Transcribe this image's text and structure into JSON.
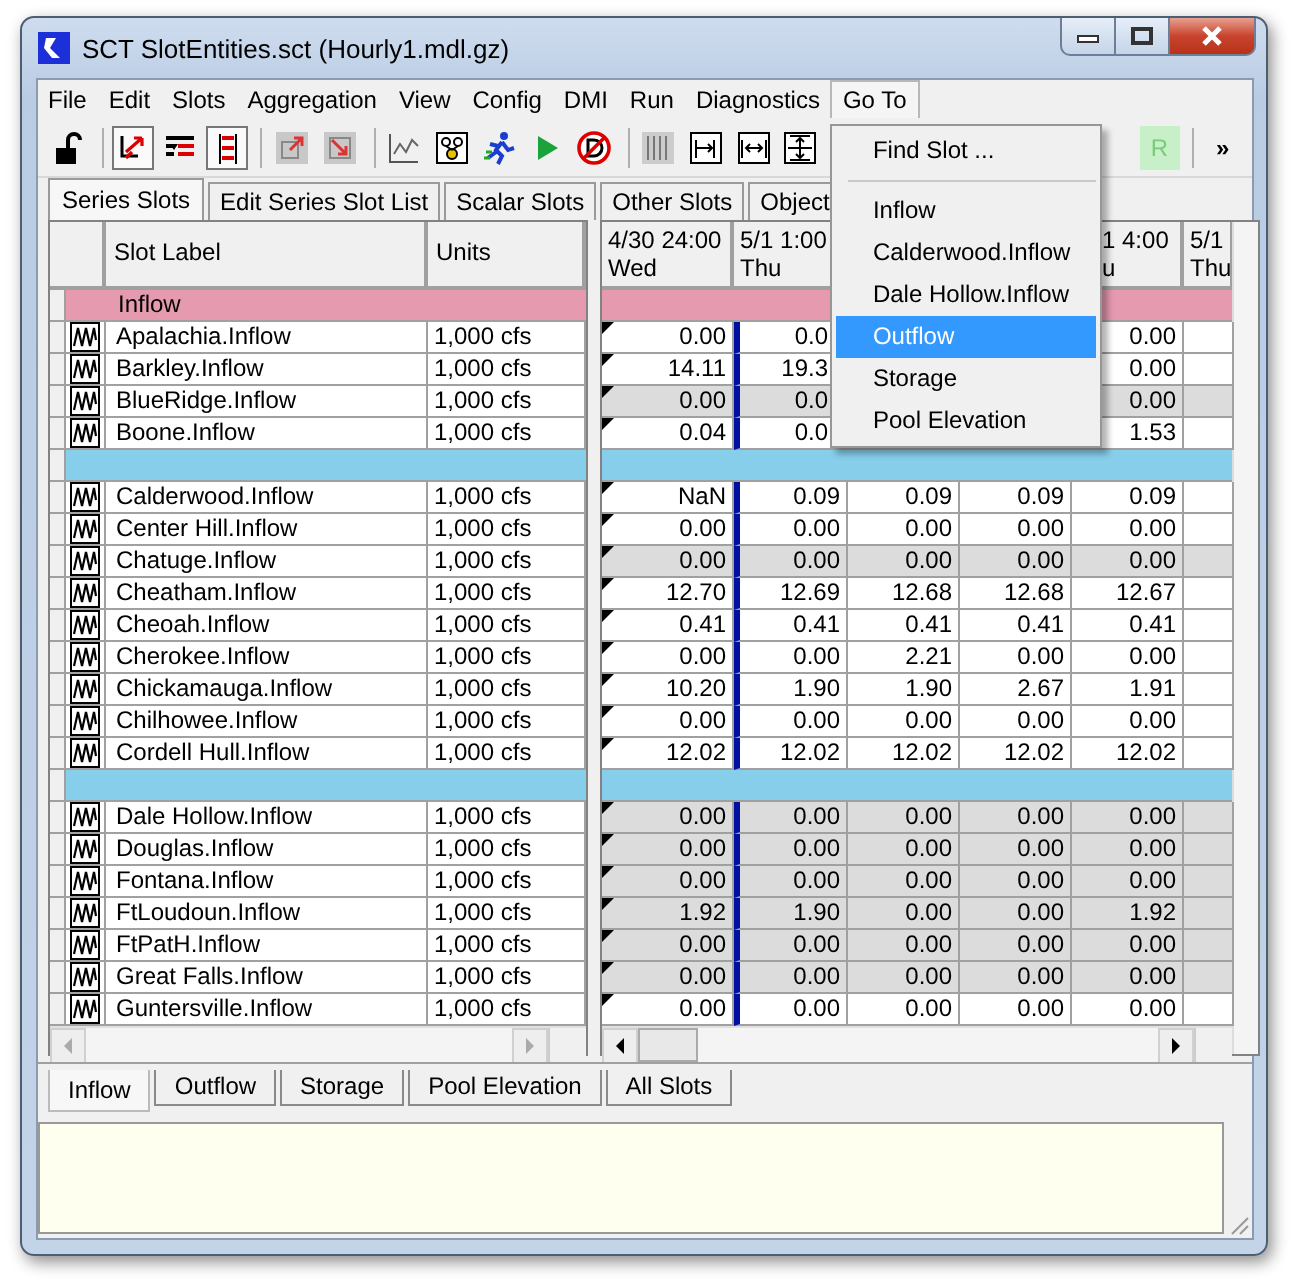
{
  "window": {
    "title": "SCT SlotEntities.sct (Hourly1.mdl.gz)"
  },
  "menu_bar": [
    {
      "label": "File",
      "selected": false
    },
    {
      "label": "Edit",
      "selected": false
    },
    {
      "label": "Slots",
      "selected": false
    },
    {
      "label": "Aggregation",
      "selected": false
    },
    {
      "label": "View",
      "selected": false
    },
    {
      "label": "Config",
      "selected": false
    },
    {
      "label": "DMI",
      "selected": false
    },
    {
      "label": "Run",
      "selected": false
    },
    {
      "label": "Diagnostics",
      "selected": false
    },
    {
      "label": "Go To",
      "selected": true
    }
  ],
  "toolbar": [
    {
      "kind": "lock",
      "pressed": false
    },
    {
      "kind": "separator"
    },
    {
      "kind": "arrows",
      "pressed": true
    },
    {
      "kind": "list",
      "pressed": false
    },
    {
      "kind": "bars",
      "pressed": true
    },
    {
      "kind": "separator"
    },
    {
      "kind": "arrow-out",
      "pressed": false
    },
    {
      "kind": "arrow-in",
      "pressed": false
    },
    {
      "kind": "separator"
    },
    {
      "kind": "chart",
      "pressed": false
    },
    {
      "kind": "diagram",
      "pressed": false
    },
    {
      "kind": "runner",
      "pressed": false
    },
    {
      "kind": "play",
      "pressed": false
    },
    {
      "kind": "stop",
      "pressed": false
    },
    {
      "kind": "separator"
    },
    {
      "kind": "stripes",
      "pressed": false
    },
    {
      "kind": "fit-right",
      "pressed": false
    },
    {
      "kind": "fit-both",
      "pressed": false
    },
    {
      "kind": "fit-full",
      "pressed": false
    },
    {
      "kind": "gap"
    },
    {
      "kind": "text",
      "label": "R",
      "pressed": false
    },
    {
      "kind": "separator"
    },
    {
      "kind": "more",
      "label": "»",
      "pressed": false
    }
  ],
  "goto_menu": [
    {
      "kind": "item",
      "label": "Find Slot ...",
      "selected": false
    },
    {
      "kind": "separator"
    },
    {
      "kind": "item",
      "label": "Inflow",
      "selected": false
    },
    {
      "kind": "item",
      "label": "Calderwood.Inflow",
      "selected": false
    },
    {
      "kind": "item",
      "label": "Dale Hollow.Inflow",
      "selected": false
    },
    {
      "kind": "item",
      "label": "Outflow",
      "selected": true
    },
    {
      "kind": "item",
      "label": "Storage",
      "selected": false
    },
    {
      "kind": "item",
      "label": "Pool Elevation",
      "selected": false
    }
  ],
  "tabs": [
    {
      "label": "Series Slots",
      "selected": true
    },
    {
      "label": "Edit Series Slot List",
      "selected": false
    },
    {
      "label": "Scalar Slots",
      "selected": false
    },
    {
      "label": "Other Slots",
      "selected": false
    },
    {
      "label": "Object",
      "selected": false
    }
  ],
  "slot_table": {
    "columns": [
      "Slot Label",
      "Units"
    ]
  },
  "value_table": {
    "columns": {
      "column_1": "4/30 24:00\nWed",
      "column_2": "5/1 1:00\nThu",
      "column_5": "1 4:00\nu",
      "column_6": "5/1\nThu"
    }
  },
  "rows": [
    {
      "kind": "group",
      "label": "Inflow",
      "color": "#e59ab0"
    },
    {
      "kind": "slot",
      "label": "Apalachia.Inflow",
      "units": "1,000 cfs",
      "shaded": false,
      "values": {
        "column_1": "0.00",
        "column_2": "0.0",
        "column_5": "0.00"
      }
    },
    {
      "kind": "slot",
      "label": "Barkley.Inflow",
      "units": "1,000 cfs",
      "shaded": false,
      "values": {
        "column_1": "14.11",
        "column_2": "19.3",
        "column_5": "0.00"
      }
    },
    {
      "kind": "slot",
      "label": "BlueRidge.Inflow",
      "units": "1,000 cfs",
      "shaded": true,
      "values": {
        "column_1": "0.00",
        "column_2": "0.0",
        "column_5": "0.00"
      }
    },
    {
      "kind": "slot",
      "label": "Boone.Inflow",
      "units": "1,000 cfs",
      "shaded": false,
      "values": {
        "column_1": "0.04",
        "column_2": "0.0",
        "column_5": "1.53"
      }
    },
    {
      "kind": "group",
      "color": "#87ceeb"
    },
    {
      "kind": "slot",
      "label": "Calderwood.Inflow",
      "units": "1,000 cfs",
      "shaded": false,
      "values": {
        "column_1": "NaN",
        "column_2": "0.09",
        "column_3": "0.09",
        "column_4": "0.09",
        "column_5": "0.09"
      }
    },
    {
      "kind": "slot",
      "label": "Center Hill.Inflow",
      "units": "1,000 cfs",
      "shaded": false,
      "values": {
        "column_1": "0.00",
        "column_2": "0.00",
        "column_3": "0.00",
        "column_4": "0.00",
        "column_5": "0.00"
      }
    },
    {
      "kind": "slot",
      "label": "Chatuge.Inflow",
      "units": "1,000 cfs",
      "shaded": true,
      "values": {
        "column_1": "0.00",
        "column_2": "0.00",
        "column_3": "0.00",
        "column_4": "0.00",
        "column_5": "0.00"
      }
    },
    {
      "kind": "slot",
      "label": "Cheatham.Inflow",
      "units": "1,000 cfs",
      "shaded": false,
      "values": {
        "column_1": "12.70",
        "column_2": "12.69",
        "column_3": "12.68",
        "column_4": "12.68",
        "column_5": "12.67"
      }
    },
    {
      "kind": "slot",
      "label": "Cheoah.Inflow",
      "units": "1,000 cfs",
      "shaded": false,
      "values": {
        "column_1": "0.41",
        "column_2": "0.41",
        "column_3": "0.41",
        "column_4": "0.41",
        "column_5": "0.41"
      }
    },
    {
      "kind": "slot",
      "label": "Cherokee.Inflow",
      "units": "1,000 cfs",
      "shaded": false,
      "values": {
        "column_1": "0.00",
        "column_2": "0.00",
        "column_3": "2.21",
        "column_4": "0.00",
        "column_5": "0.00"
      }
    },
    {
      "kind": "slot",
      "label": "Chickamauga.Inflow",
      "units": "1,000 cfs",
      "shaded": false,
      "values": {
        "column_1": "10.20",
        "column_2": "1.90",
        "column_3": "1.90",
        "column_4": "2.67",
        "column_5": "1.91"
      }
    },
    {
      "kind": "slot",
      "label": "Chilhowee.Inflow",
      "units": "1,000 cfs",
      "shaded": false,
      "values": {
        "column_1": "0.00",
        "column_2": "0.00",
        "column_3": "0.00",
        "column_4": "0.00",
        "column_5": "0.00"
      }
    },
    {
      "kind": "slot",
      "label": "Cordell Hull.Inflow",
      "units": "1,000 cfs",
      "shaded": false,
      "values": {
        "column_1": "12.02",
        "column_2": "12.02",
        "column_3": "12.02",
        "column_4": "12.02",
        "column_5": "12.02"
      }
    },
    {
      "kind": "group",
      "color": "#87ceeb"
    },
    {
      "kind": "slot",
      "label": "Dale Hollow.Inflow",
      "units": "1,000 cfs",
      "shaded": true,
      "values": {
        "column_1": "0.00",
        "column_2": "0.00",
        "column_3": "0.00",
        "column_4": "0.00",
        "column_5": "0.00"
      }
    },
    {
      "kind": "slot",
      "label": "Douglas.Inflow",
      "units": "1,000 cfs",
      "shaded": true,
      "values": {
        "column_1": "0.00",
        "column_2": "0.00",
        "column_3": "0.00",
        "column_4": "0.00",
        "column_5": "0.00"
      }
    },
    {
      "kind": "slot",
      "label": "Fontana.Inflow",
      "units": "1,000 cfs",
      "shaded": true,
      "values": {
        "column_1": "0.00",
        "column_2": "0.00",
        "column_3": "0.00",
        "column_4": "0.00",
        "column_5": "0.00"
      }
    },
    {
      "kind": "slot",
      "label": "FtLoudoun.Inflow",
      "units": "1,000 cfs",
      "shaded": true,
      "values": {
        "column_1": "1.92",
        "column_2": "1.90",
        "column_3": "0.00",
        "column_4": "0.00",
        "column_5": "1.92"
      }
    },
    {
      "kind": "slot",
      "label": "FtPatH.Inflow",
      "units": "1,000 cfs",
      "shaded": true,
      "values": {
        "column_1": "0.00",
        "column_2": "0.00",
        "column_3": "0.00",
        "column_4": "0.00",
        "column_5": "0.00"
      }
    },
    {
      "kind": "slot",
      "label": "Great Falls.Inflow",
      "units": "1,000 cfs",
      "shaded": true,
      "values": {
        "column_1": "0.00",
        "column_2": "0.00",
        "column_3": "0.00",
        "column_4": "0.00",
        "column_5": "0.00"
      }
    },
    {
      "kind": "slot",
      "label": "Guntersville.Inflow",
      "units": "1,000 cfs",
      "shaded": false,
      "values": {
        "column_1": "0.00",
        "column_2": "0.00",
        "column_3": "0.00",
        "column_4": "0.00",
        "column_5": "0.00"
      }
    }
  ],
  "bottom_tabs": [
    {
      "label": "Inflow",
      "selected": true
    },
    {
      "label": "Outflow",
      "selected": false
    },
    {
      "label": "Storage",
      "selected": false
    },
    {
      "label": "Pool Elevation",
      "selected": false
    },
    {
      "label": "All Slots",
      "selected": false
    }
  ]
}
